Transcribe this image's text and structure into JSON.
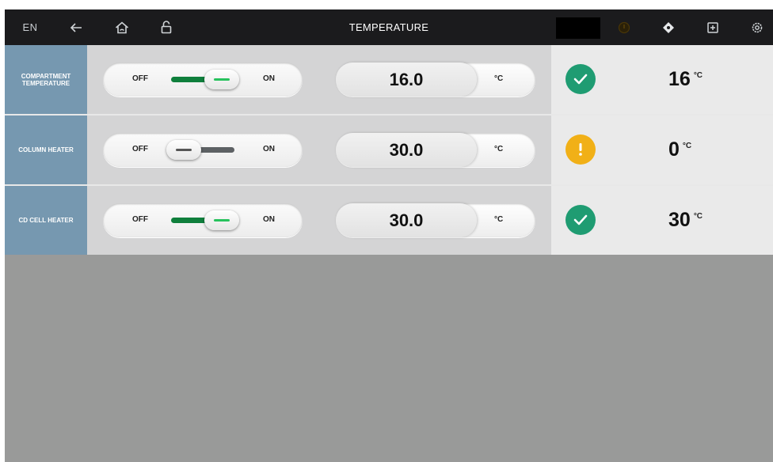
{
  "topbar": {
    "language": "EN",
    "title": "TEMPERATURE",
    "icons": [
      "back-arrow-icon",
      "home-icon",
      "unlock-icon",
      "status-indicator-icon",
      "navigation-icon",
      "import-icon",
      "gear-icon"
    ],
    "status_indicator_color": "#3a2a05"
  },
  "colors": {
    "label_bg": "#7698b0",
    "switch_on": "#0f7f3c",
    "status_ok": "#1f9c72",
    "status_warn": "#f1b017"
  },
  "rows": [
    {
      "label": "COMPARTMENT TEMPERATURE",
      "toggle": {
        "off_label": "OFF",
        "on_label": "ON",
        "state": "on"
      },
      "setpoint": {
        "value": "16.0",
        "unit": "°C"
      },
      "status": "ok",
      "actual": {
        "value": "16",
        "unit": "°C"
      }
    },
    {
      "label": "COLUMN HEATER",
      "toggle": {
        "off_label": "OFF",
        "on_label": "ON",
        "state": "off"
      },
      "setpoint": {
        "value": "30.0",
        "unit": "°C"
      },
      "status": "warning",
      "actual": {
        "value": "0",
        "unit": "°C"
      }
    },
    {
      "label": "CD CELL HEATER",
      "toggle": {
        "off_label": "OFF",
        "on_label": "ON",
        "state": "on"
      },
      "setpoint": {
        "value": "30.0",
        "unit": "°C"
      },
      "status": "ok",
      "actual": {
        "value": "30",
        "unit": "°C"
      }
    }
  ]
}
